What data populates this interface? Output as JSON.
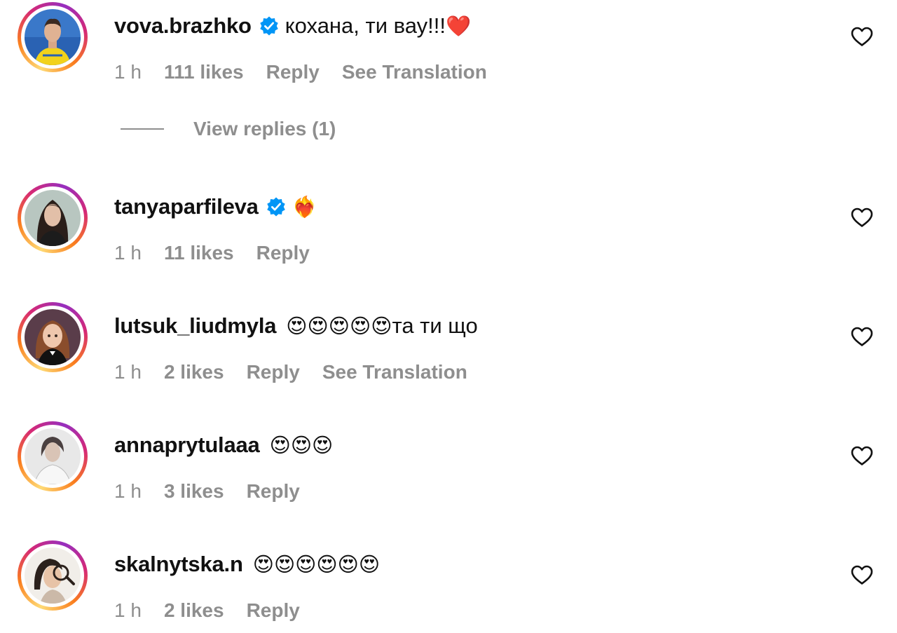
{
  "colors": {
    "meta_text": "#8e8e8e",
    "verified_blue": "#0095f6",
    "heart_red": "#e8153b"
  },
  "comments": [
    {
      "username": "vova.brazhko",
      "verified": true,
      "text": "кохана, ти вау!!!",
      "emoji": "❤️",
      "time": "1 h",
      "likes": "111 likes",
      "reply": "Reply",
      "translate": "See Translation",
      "view_replies": "View replies (1)"
    },
    {
      "username": "tanyaparfileva",
      "verified": true,
      "text": "",
      "emoji": "❤️‍🔥",
      "time": "1 h",
      "likes": "11 likes",
      "reply": "Reply"
    },
    {
      "username": "lutsuk_liudmyla",
      "verified": false,
      "emoji": "😍😍😍😍😍",
      "text": "та ти що",
      "time": "1 h",
      "likes": "2 likes",
      "reply": "Reply",
      "translate": "See Translation"
    },
    {
      "username": "annaprytulaaa",
      "verified": false,
      "emoji": "😍😍😍",
      "time": "1 h",
      "likes": "3 likes",
      "reply": "Reply"
    },
    {
      "username": "skalnytska.n",
      "verified": false,
      "emoji": "😍😍😍😍😍😍",
      "time": "1 h",
      "likes": "2 likes",
      "reply": "Reply"
    }
  ]
}
